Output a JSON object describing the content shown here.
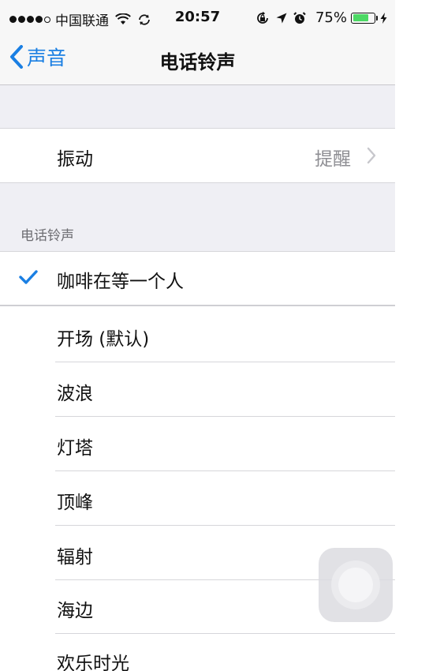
{
  "status_bar": {
    "carrier": "中国联通",
    "time": "20:57",
    "battery_percent": "75%",
    "battery_level": 0.75,
    "signal_bars": 4,
    "signal_max": 5
  },
  "nav": {
    "back_label": "声音",
    "title": "电话铃声"
  },
  "vibration_row": {
    "label": "振动",
    "value": "提醒"
  },
  "ringtone_section": {
    "header": "电话铃声",
    "selected": "咖啡在等一个人",
    "items": [
      "咖啡在等一个人",
      "开场 (默认)",
      "波浪",
      "灯塔",
      "顶峰",
      "辐射",
      "海边",
      "欢乐时光"
    ]
  },
  "colors": {
    "accent": "#1a7fe3",
    "group_background": "#efeff4",
    "bar_background": "#f7f7f7",
    "battery_fill": "#4cd964",
    "secondary_text": "#8e8e93"
  },
  "icons": {
    "back": "chevron-left-icon",
    "disclosure": "chevron-right-icon",
    "selected": "checkmark-icon",
    "wifi": "wifi-icon",
    "sync": "sync-icon",
    "rotation_lock": "rotation-lock-icon",
    "location": "location-arrow-icon",
    "alarm": "alarm-clock-icon",
    "charging": "charging-bolt-icon"
  }
}
